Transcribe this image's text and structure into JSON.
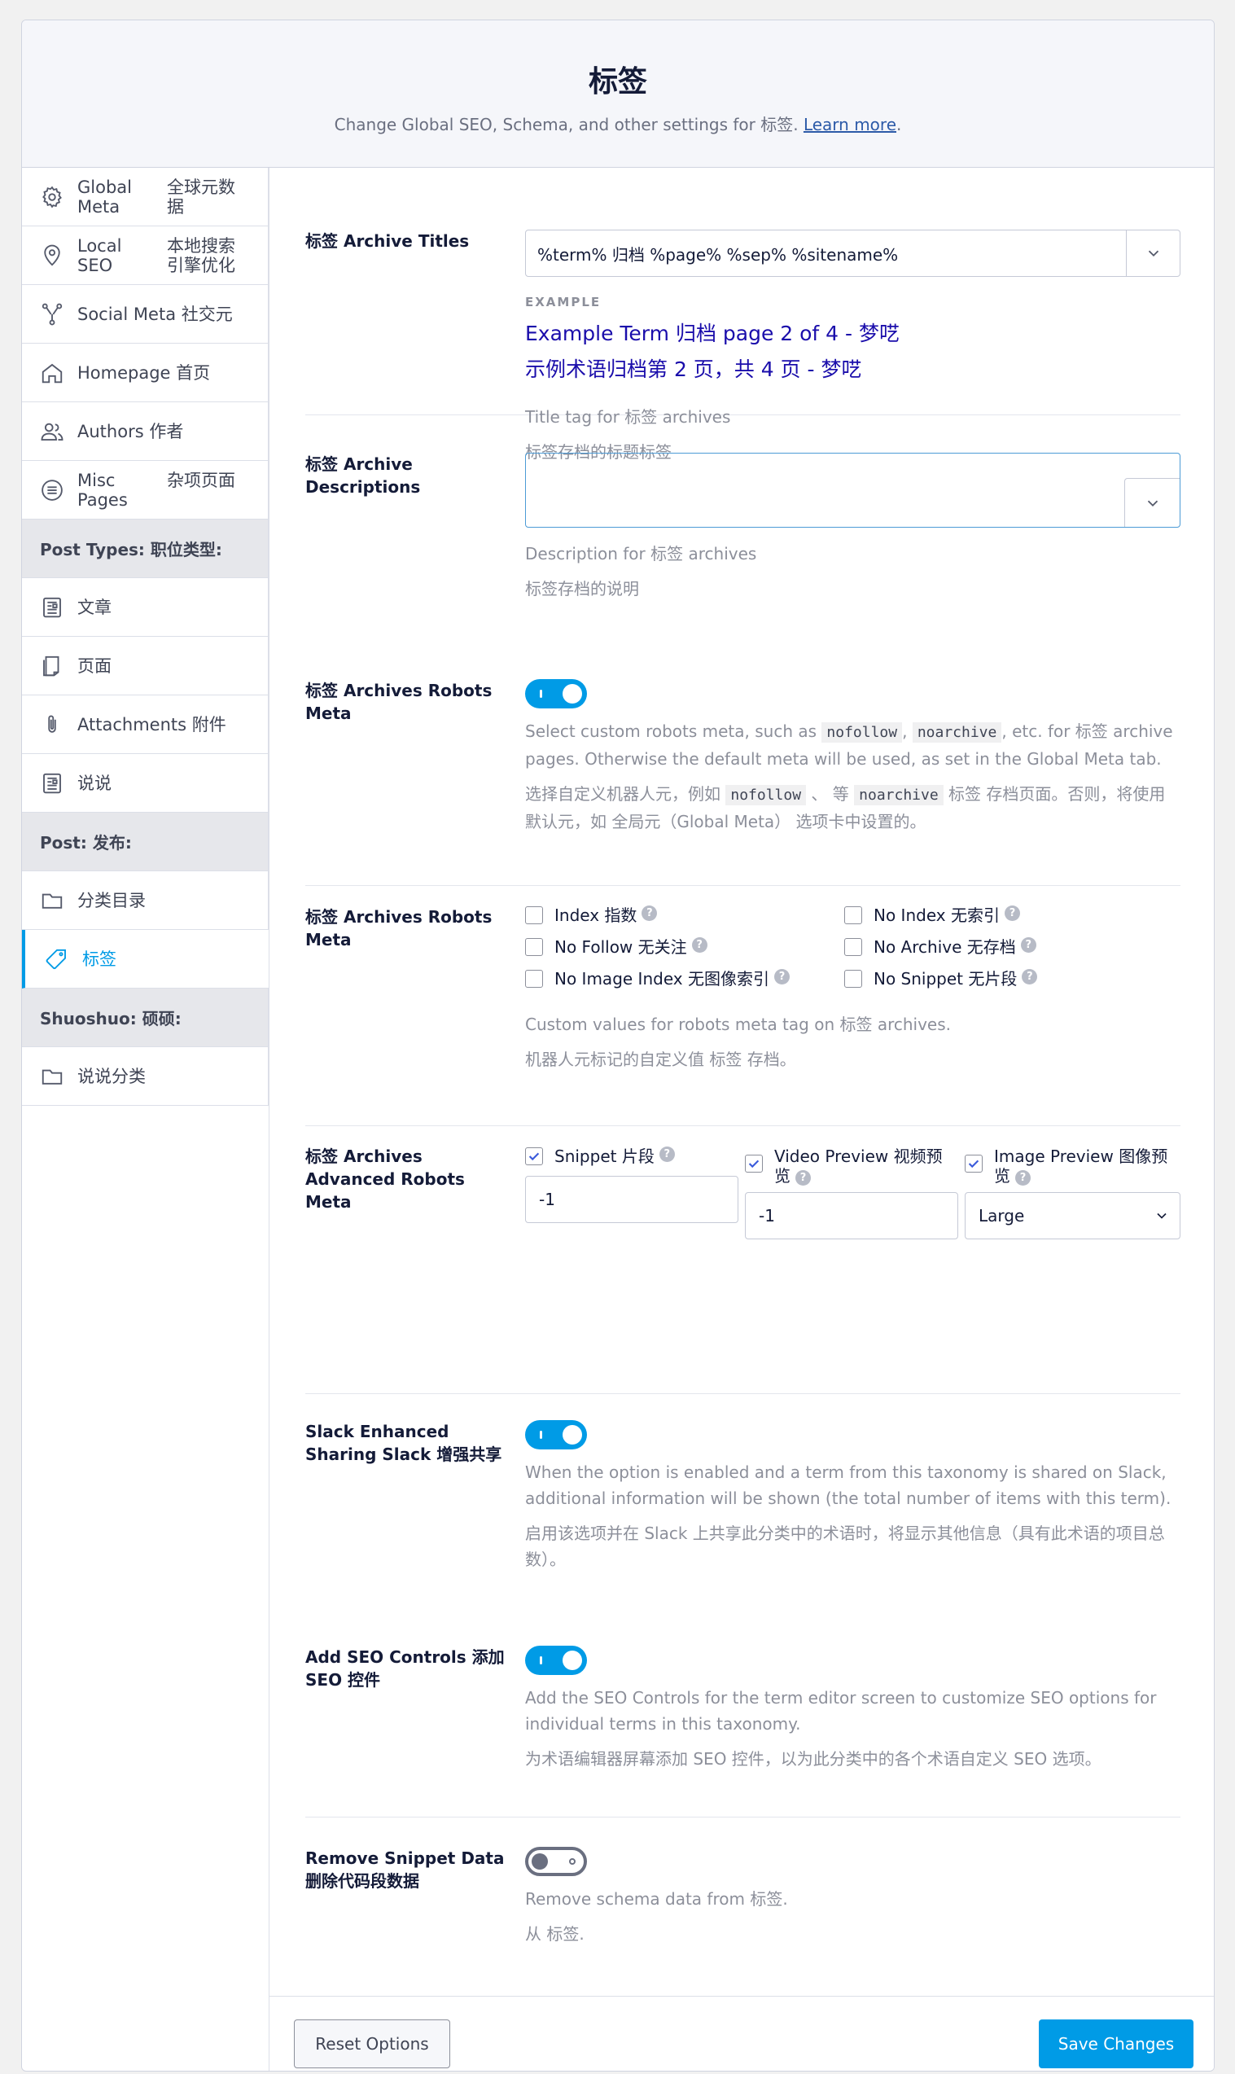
{
  "header": {
    "title": "标签",
    "subtitle": "Change Global SEO, Schema, and other settings for 标签.",
    "learn_more": "Learn more",
    "period": "."
  },
  "sidebar": {
    "items": [
      {
        "en": "Global Meta",
        "zh": "全球元数据",
        "icon": "gear-icon"
      },
      {
        "en": "Local SEO",
        "zh": "本地搜索引擎优化",
        "icon": "map-pin-icon"
      },
      {
        "label": "Social Meta  社交元",
        "icon": "share-nodes-icon"
      },
      {
        "label": "Homepage  首页",
        "icon": "home-icon"
      },
      {
        "label": "Authors  作者",
        "icon": "users-icon"
      },
      {
        "en": "Misc Pages",
        "zh": "杂项页面",
        "icon": "list-circle-icon"
      }
    ],
    "post_types_header": "Post Types:  职位类型:",
    "post_types": [
      {
        "label": "文章",
        "icon": "document-icon"
      },
      {
        "label": "页面",
        "icon": "page-icon"
      },
      {
        "label": "Attachments  附件",
        "icon": "paperclip-icon"
      },
      {
        "label": "说说",
        "icon": "document-icon"
      }
    ],
    "post_header": "Post:  发布:",
    "post_items": [
      {
        "label": "分类目录",
        "icon": "folder-icon"
      },
      {
        "label": "标签",
        "icon": "tag-icon",
        "active": true
      }
    ],
    "shuoshuo_header": "Shuoshuo:  硕硕:",
    "shuoshuo_items": [
      {
        "label": "说说分类",
        "icon": "folder-icon"
      }
    ]
  },
  "titles": {
    "label": "标签 Archive Titles",
    "value": "%term% 归档 %page% %sep% %sitename%",
    "example_label": "EXAMPLE",
    "example_1": "Example Term 归档 page 2 of 4 - 梦呓",
    "example_2": "示例术语归档第 2 页，共 4 页 - 梦呓",
    "help_en": "Title tag for 标签 archives",
    "help_zh": "标签存档的标题标签"
  },
  "descriptions": {
    "label": "标签 Archive Descriptions",
    "value": "",
    "help_en": "Description for 标签 archives",
    "help_zh": "标签存档的说明"
  },
  "robots_toggle": {
    "label": "标签 Archives Robots Meta",
    "help_en_1": "Select custom robots meta, such as",
    "code_1": "nofollow",
    "sep": ",",
    "code_2": "noarchive",
    "help_en_2": ", etc. for 标签 archive pages. Otherwise the default meta will be used, as set in the Global Meta tab.",
    "help_zh_1": "选择自定义机器人元，例如",
    "zh_sep": "、 等",
    "help_zh_2": "标签 存档页面。否则，将使用默认元，如 全局元（Global Meta） 选项卡中设置的。"
  },
  "robots_checks": {
    "label": "标签 Archives Robots Meta",
    "left": [
      "Index  指数",
      "No Follow  无关注",
      "No Image Index  无图像索引"
    ],
    "right": [
      "No Index  无索引",
      "No Archive  无存档",
      "No Snippet  无片段"
    ],
    "help_en": "Custom values for robots meta tag on 标签 archives.",
    "help_zh": "机器人元标记的自定义值 标签 存档。"
  },
  "advanced": {
    "label": "标签 Archives Advanced Robots Meta",
    "snippet": "Snippet  片段",
    "snippet_value": "-1",
    "video": "Video Preview  视频预览",
    "video_value": "-1",
    "image": "Image Preview  图像预览",
    "image_value": "Large"
  },
  "slack": {
    "label": "Slack Enhanced Sharing  Slack 增强共享",
    "help_en": "When the option is enabled and a term from this taxonomy is shared on Slack, additional information will be shown (the total number of items with this term).",
    "help_zh": "启用该选项并在 Slack 上共享此分类中的术语时，将显示其他信息（具有此术语的项目总数）。"
  },
  "seo_controls": {
    "label": "Add SEO Controls  添加 SEO 控件",
    "help_en": "Add the SEO Controls for the term editor screen to customize SEO options for individual terms in this taxonomy.",
    "help_zh": "为术语编辑器屏幕添加 SEO 控件，以为此分类中的各个术语自定义 SEO 选项。"
  },
  "snippet_data": {
    "label": "Remove Snippet Data  删除代码段数据",
    "help_en": "Remove schema data from 标签.",
    "help_zh": "从 标签."
  },
  "footer": {
    "reset": "Reset Options",
    "save": "Save Changes"
  },
  "colors": {
    "accent": "#009be6",
    "example_link": "#1a0dab"
  }
}
